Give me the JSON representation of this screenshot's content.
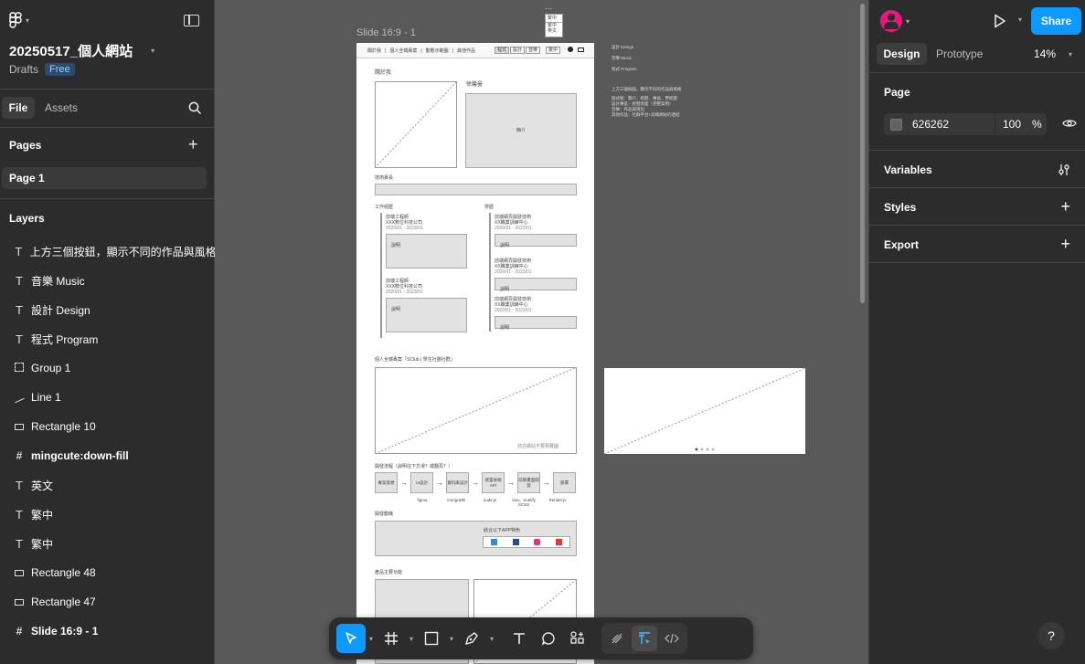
{
  "toolbar_left": {
    "logo": "figma-menu",
    "file_title": "20250517_個人網站",
    "drafts": "Drafts",
    "plan": "Free"
  },
  "tabs": {
    "file": "File",
    "assets": "Assets"
  },
  "pages": {
    "header": "Pages",
    "items": [
      "Page 1"
    ]
  },
  "layers": {
    "header": "Layers",
    "items": [
      {
        "icon": "T",
        "label": "上方三個按鈕，顯示不同的作品與風格 顯"
      },
      {
        "icon": "T",
        "label": "音樂 Music"
      },
      {
        "icon": "T",
        "label": "設計 Design"
      },
      {
        "icon": "T",
        "label": "程式 Program"
      },
      {
        "icon": "group",
        "label": "Group 1"
      },
      {
        "icon": "line",
        "label": "Line 1"
      },
      {
        "icon": "rect",
        "label": "Rectangle 10"
      },
      {
        "icon": "#",
        "label": "mingcute:down-fill"
      },
      {
        "icon": "T",
        "label": "英文"
      },
      {
        "icon": "T",
        "label": "繁中"
      },
      {
        "icon": "T",
        "label": "繁中"
      },
      {
        "icon": "rect",
        "label": "Rectangle 48"
      },
      {
        "icon": "rect",
        "label": "Rectangle 47"
      },
      {
        "icon": "#",
        "label": "Slide 16:9 - 1"
      }
    ]
  },
  "canvas": {
    "frame_label": "Slide 16:9 - 1",
    "nav": [
      "關於我",
      "個人全端專案",
      "動態示範圖",
      "其他作品"
    ],
    "nav_btns": [
      "程式",
      "設計",
      "音樂"
    ],
    "lang": "繁中",
    "lang_menu": [
      "繁中",
      "英文"
    ],
    "about": "關於我",
    "name": "徐馨曼",
    "intro": "簡介",
    "skills": "技術專長",
    "work": "工作經歷",
    "edu": "學歷",
    "job_title": "前端工程師",
    "job_company": "XXX數位科技公司",
    "job_date": "2020/01 - 2023/01",
    "desc": "說明",
    "edu_title": "前端網頁開發技術",
    "edu_org": "XX職業訓練中心",
    "project_title": "個人全端專案「SClub | 學生社團社群」",
    "project_btn": "前往網站不要預覽圖",
    "flow_title": "開發流程（說明往下方滑？或翻頁？）",
    "flow": [
      "專案發想",
      "UI設計",
      "資料庫設計",
      "建置後端API",
      "前端畫面開發",
      "部署"
    ],
    "flow_tools": [
      "figma",
      "mongoDB",
      "node.js",
      "Vue、Vuetify SCSS",
      "Render.js"
    ],
    "dev": "開發動機",
    "dev_sub": "結合以下APP特色",
    "features": "產品主要功能",
    "notes": [
      "音樂 Music",
      "設計 Design",
      "程式 Program"
    ],
    "note_para": [
      "上方三個按鈕，顯示不同的作品與風格",
      "程式版：簡介、經歷、專長、學經歷",
      "設計專區：經營頁面（完整案例）",
      "音樂：作品與演出",
      "其他作品：社群平台+前端網站的連結"
    ]
  },
  "right": {
    "tabs": {
      "design": "Design",
      "prototype": "Prototype"
    },
    "zoom": "14%",
    "share": "Share",
    "page": "Page",
    "color": "626262",
    "opacity": "100",
    "percent": "%",
    "variables": "Variables",
    "styles": "Styles",
    "export": "Export",
    "help": "?"
  },
  "colors": {
    "accent": "#0d99ff",
    "panel": "#2c2c2c",
    "canvas": "#595959",
    "page_fill": "#626262"
  }
}
